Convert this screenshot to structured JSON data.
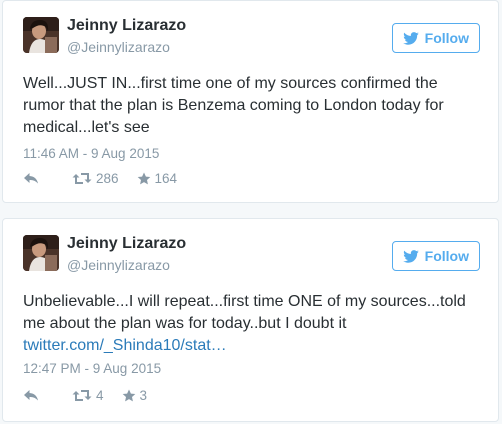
{
  "tweets": [
    {
      "author": {
        "name": "Jeinny Lizarazo",
        "handle": "@Jeinnylizarazo"
      },
      "follow_label": "Follow",
      "text": "Well...JUST IN...first time one of my sources confirmed the rumor that the plan is Benzema coming to London today for medical...let's see",
      "link": "",
      "timestamp": "11:46 AM - 9 Aug 2015",
      "retweets": "286",
      "favorites": "164"
    },
    {
      "author": {
        "name": "Jeinny Lizarazo",
        "handle": "@Jeinnylizarazo"
      },
      "follow_label": "Follow",
      "text": "Unbelievable...I will repeat...first time ONE of my sources...told me about the plan was for today..but I doubt it",
      "link": "twitter.com/_Shinda10/stat…",
      "timestamp": "12:47 PM - 9 Aug 2015",
      "retweets": "4",
      "favorites": "3"
    }
  ],
  "icons": {
    "follow": "twitter-bird-icon",
    "reply": "reply-icon",
    "retweet": "retweet-icon",
    "favorite": "star-icon"
  },
  "colors": {
    "accent": "#55acee",
    "link": "#2b7bb9",
    "muted": "#8899a6",
    "text": "#292f33"
  }
}
